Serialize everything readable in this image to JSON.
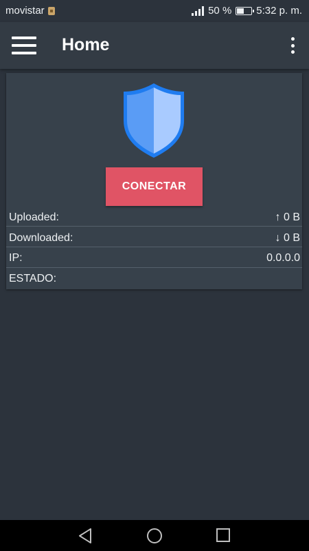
{
  "status_bar": {
    "carrier": "movistar",
    "battery_percent": "50 %",
    "time": "5:32 p. m."
  },
  "app_bar": {
    "title": "Home"
  },
  "connect": {
    "button_label": "CONECTAR"
  },
  "info": {
    "rows": [
      {
        "label": "Uploaded:",
        "value": "↑ 0 B"
      },
      {
        "label": "Downloaded:",
        "value": "↓ 0 B"
      },
      {
        "label": "IP:",
        "value": "0.0.0.0"
      },
      {
        "label": "ESTADO:",
        "value": ""
      }
    ]
  },
  "icons": {
    "menu": "hamburger-menu-icon",
    "more": "more-vert-icon",
    "shield": "shield-icon",
    "nav_back": "back-triangle-icon",
    "nav_home": "home-circle-icon",
    "nav_recents": "recents-square-icon"
  },
  "colors": {
    "background": "#2c333c",
    "app_bar": "#333b44",
    "card": "#37414b",
    "connect_button": "#e05465",
    "shield_dark": "#4a90f0",
    "shield_light": "#a9cbff"
  }
}
